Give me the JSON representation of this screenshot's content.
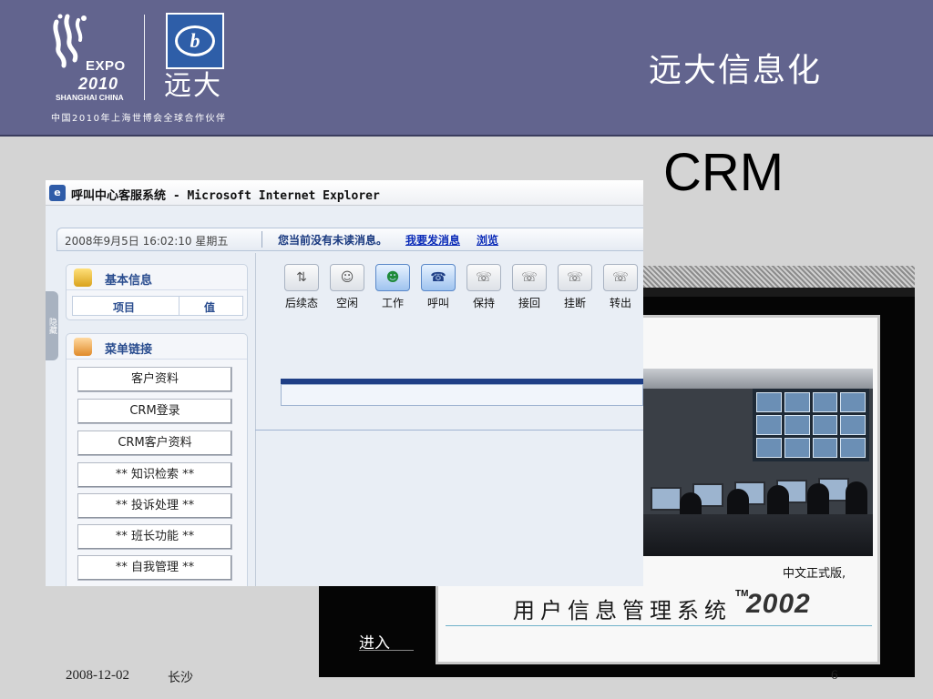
{
  "header": {
    "expo_word": "EXPO",
    "expo_year": "2010",
    "expo_city": "SHANGHAI CHINA",
    "company_short": "远大",
    "partner_text": "中国2010年上海世博会全球合作伙伴",
    "company_title": "远大信息化"
  },
  "slide": {
    "title": "CRM",
    "footer_date": "2008-12-02",
    "footer_location": "长沙",
    "page_number": "6"
  },
  "ie_window": {
    "title": "呼叫中心客服系统 - Microsoft Internet Explorer",
    "datetime": "2008年9月5日 16:02:10 星期五",
    "message": "您当前没有未读消息。",
    "link_send": "我要发消息",
    "link_browse": "浏览",
    "side_tab": "隐藏",
    "basic_info": {
      "title": "基本信息",
      "col_item": "项目",
      "col_value": "值"
    },
    "menu_links": {
      "title": "菜单链接",
      "items": [
        "客户资料",
        "CRM登录",
        "CRM客户资料",
        "** 知识检索 **",
        "** 投诉处理 **",
        "** 班长功能 **",
        "** 自我管理 **"
      ]
    },
    "toolbar": [
      {
        "label": "后续态",
        "icon": "status-icon",
        "glyph": "⇅",
        "active": false
      },
      {
        "label": "空闲",
        "icon": "idle-agent-icon",
        "glyph": "☺",
        "active": false
      },
      {
        "label": "工作",
        "icon": "working-agent-icon",
        "glyph": "☻",
        "active": true
      },
      {
        "label": "呼叫",
        "icon": "call-phone-icon",
        "glyph": "☎",
        "active": true
      },
      {
        "label": "保持",
        "icon": "hold-phone-icon",
        "glyph": "☏",
        "active": false
      },
      {
        "label": "接回",
        "icon": "retrieve-phone-icon",
        "glyph": "☏",
        "active": false
      },
      {
        "label": "挂断",
        "icon": "hangup-phone-icon",
        "glyph": "☏",
        "active": false
      },
      {
        "label": "转出",
        "icon": "transfer-phone-icon",
        "glyph": "☏",
        "active": false
      }
    ]
  },
  "splash": {
    "edition": "中文正式版,",
    "system_name": "用户信息管理系统",
    "trademark": "TM",
    "year": "2002",
    "enter_button": "进入"
  },
  "colors": {
    "header_bg": "#62648e",
    "ie_link": "#0c2cb8",
    "panel_title": "#2a4d8f",
    "accent_bar": "#1f3f86"
  }
}
